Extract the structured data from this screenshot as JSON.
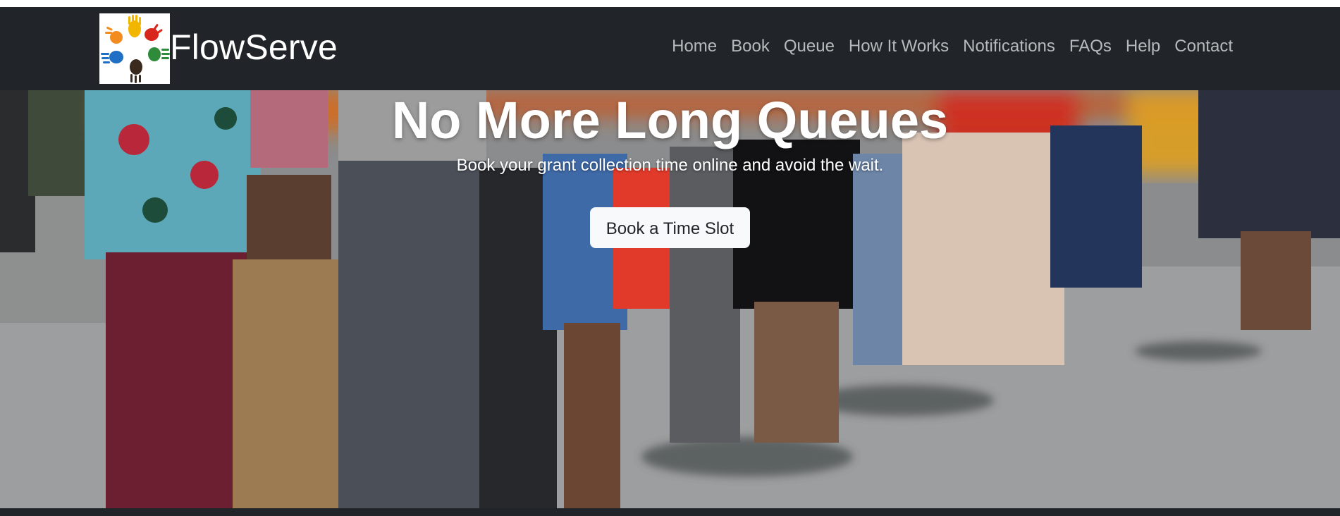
{
  "brand": {
    "name": "FlowServe",
    "logo_icon": "colorful-hands-logo"
  },
  "nav": {
    "items": [
      {
        "label": "Home"
      },
      {
        "label": "Book"
      },
      {
        "label": "Queue"
      },
      {
        "label": "How It Works"
      },
      {
        "label": "Notifications"
      },
      {
        "label": "FAQs"
      },
      {
        "label": "Help"
      },
      {
        "label": "Contact"
      }
    ]
  },
  "hero": {
    "title": "No More Long Queues",
    "subtitle": "Book your grant collection time online and avoid the wait.",
    "cta_label": "Book a Time Slot",
    "background_description_icon": "people-queue-photo"
  },
  "colors": {
    "navbar": "#212529",
    "nav_link": "#b7babd",
    "button_bg": "#f8f9fa",
    "button_text": "#212529",
    "accent_orange": "#e8661a"
  }
}
